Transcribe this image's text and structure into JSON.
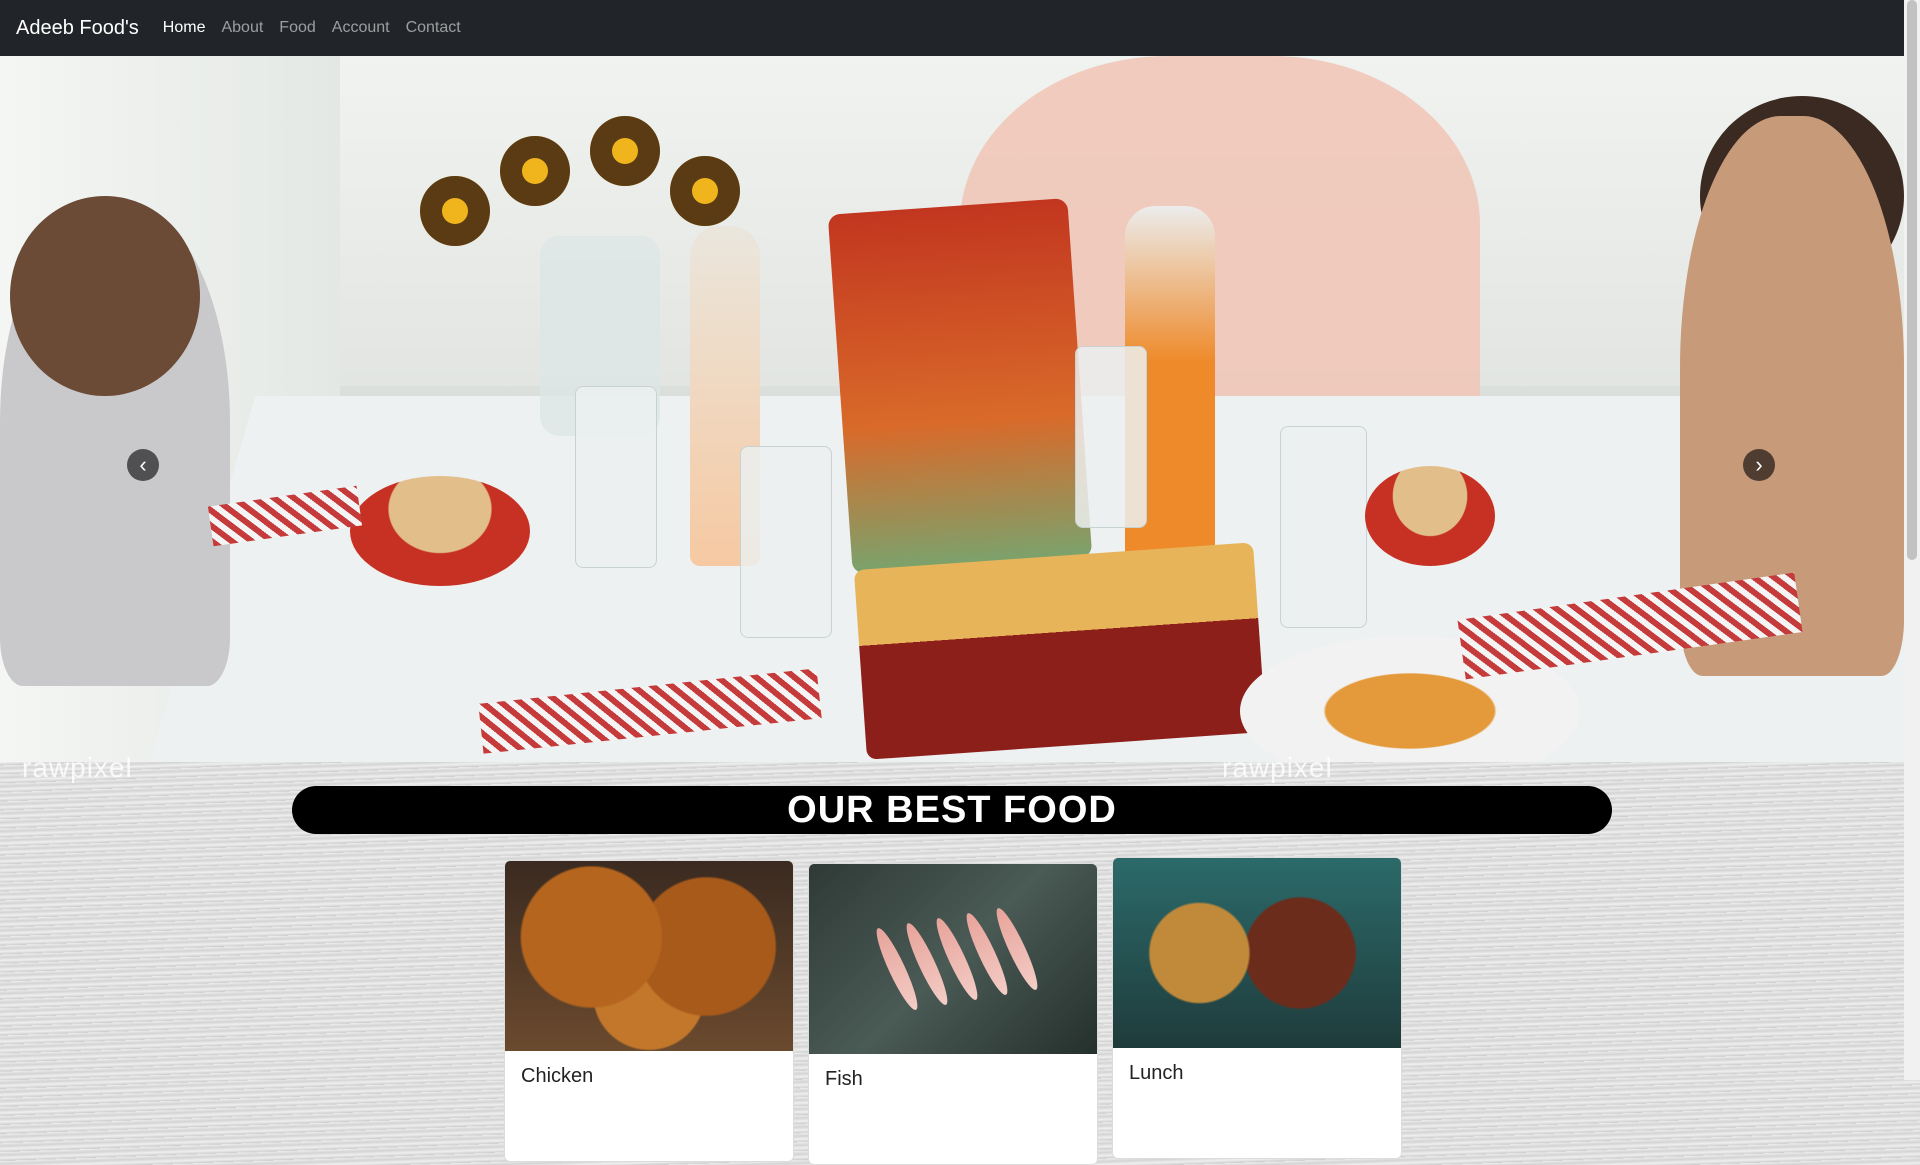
{
  "navbar": {
    "brand": "Adeeb Food's",
    "links": [
      {
        "label": "Home",
        "active": true
      },
      {
        "label": "About",
        "active": false
      },
      {
        "label": "Food",
        "active": false
      },
      {
        "label": "Account",
        "active": false
      },
      {
        "label": "Contact",
        "active": false
      }
    ]
  },
  "carousel": {
    "watermark_left": "rawpixel",
    "watermark_right": "rawpixel",
    "prev_icon": "chevron-left-icon",
    "next_icon": "chevron-right-icon"
  },
  "section": {
    "title": "OUR BEST FOOD"
  },
  "cards": [
    {
      "title": "Chicken"
    },
    {
      "title": "Fish"
    },
    {
      "title": "Lunch"
    }
  ],
  "colors": {
    "navbar_bg": "#212529",
    "title_bg": "#000000"
  }
}
